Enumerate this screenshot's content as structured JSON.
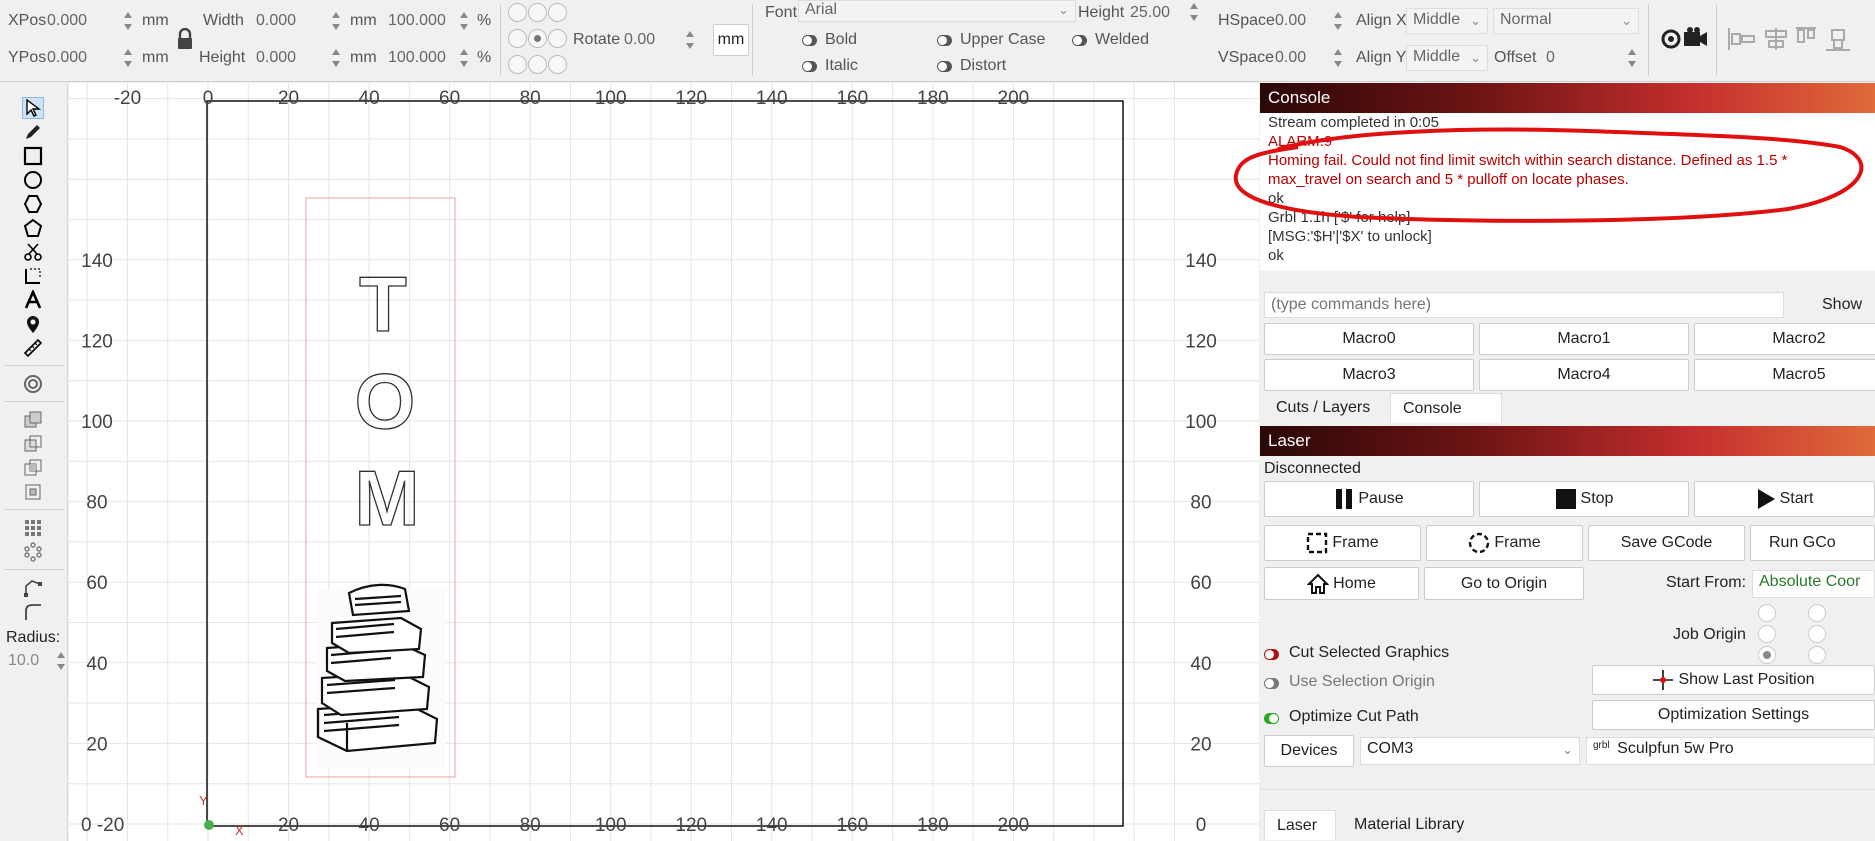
{
  "toolbar": {
    "xpos_label": "XPos",
    "xpos_value": "0.000",
    "ypos_label": "YPos",
    "ypos_value": "0.000",
    "unit_mm": "mm",
    "width_label": "Width",
    "width_value": "0.000",
    "height_label": "Height",
    "height_value": "0.000",
    "scale_x": "100.000",
    "scale_y": "100.000",
    "percent": "%",
    "rotate_label": "Rotate",
    "rotate_value": "0.00",
    "mm_button": "mm",
    "font_label": "Font",
    "font_value": "Arial",
    "font_height_label": "Height",
    "font_height_value": "25.00",
    "bold_label": "Bold",
    "italic_label": "Italic",
    "upper_case_label": "Upper Case",
    "distort_label": "Distort",
    "welded_label": "Welded",
    "hspace_label": "HSpace",
    "hspace_value": "0.00",
    "vspace_label": "VSpace",
    "vspace_value": "0.00",
    "align_x_label": "Align X",
    "align_x_value": "Middle",
    "align_y_label": "Align Y",
    "align_y_value": "Middle",
    "mode_value": "Normal",
    "offset_label": "Offset",
    "offset_value": "0"
  },
  "left_tools": {
    "radius_label": "Radius:",
    "radius_value": "10.0"
  },
  "canvas": {
    "x_ticks": [
      "-20",
      "0",
      "20",
      "40",
      "60",
      "80",
      "100",
      "120",
      "140",
      "160",
      "180",
      "200"
    ],
    "y_ticks_left": [
      "140",
      "120",
      "100",
      "80",
      "60",
      "40",
      "20"
    ],
    "y_bottom_label": "0 -20",
    "y_ticks_right": [
      "140",
      "120",
      "100",
      "80",
      "60",
      "40",
      "20",
      "0"
    ],
    "design_letters": [
      "T",
      "O",
      "M"
    ],
    "axis_x_label": "X",
    "axis_y_label": "Y"
  },
  "console": {
    "header": "Console",
    "lines": [
      "Stream completed in 0:05",
      "ALARM:9",
      "Homing fail. Could not find limit switch within search distance. Defined as 1.5 * max_travel on search and 5 * pulloff on locate phases.",
      "ok",
      "Grbl 1.1h ['$' for help]",
      "[MSG:'$H'|'$X' to unlock]",
      "ok"
    ],
    "input_placeholder": "(type commands here)",
    "show_label": "Show",
    "macros": [
      "Macro0",
      "Macro1",
      "Macro2",
      "Macro3",
      "Macro4",
      "Macro5"
    ],
    "tabs": [
      "Cuts / Layers",
      "Console"
    ]
  },
  "laser": {
    "header": "Laser",
    "status": "Disconnected",
    "pause_label": "Pause",
    "stop_label": "Stop",
    "start_label": "Start",
    "frame_rect_label": "Frame",
    "frame_circle_label": "Frame",
    "save_gcode_label": "Save GCode",
    "run_gcode_label": "Run GCo",
    "home_label": "Home",
    "go_to_origin_label": "Go to Origin",
    "start_from_label": "Start From:",
    "start_from_value": "Absolute Coor",
    "job_origin_label": "Job Origin",
    "cut_selected_label": "Cut Selected Graphics",
    "use_selection_origin_label": "Use Selection Origin",
    "optimize_cut_path_label": "Optimize Cut Path",
    "show_last_position_label": "Show Last Position",
    "optimization_settings_label": "Optimization Settings",
    "devices_label": "Devices",
    "port_value": "COM3",
    "device_value": "Sculpfun 5w Pro",
    "grbl_tag": "grbl",
    "bottom_tabs": [
      "Laser",
      "Material Library"
    ]
  },
  "colors": {
    "annotation_red": "#e01010",
    "console_error": "#b00000"
  }
}
